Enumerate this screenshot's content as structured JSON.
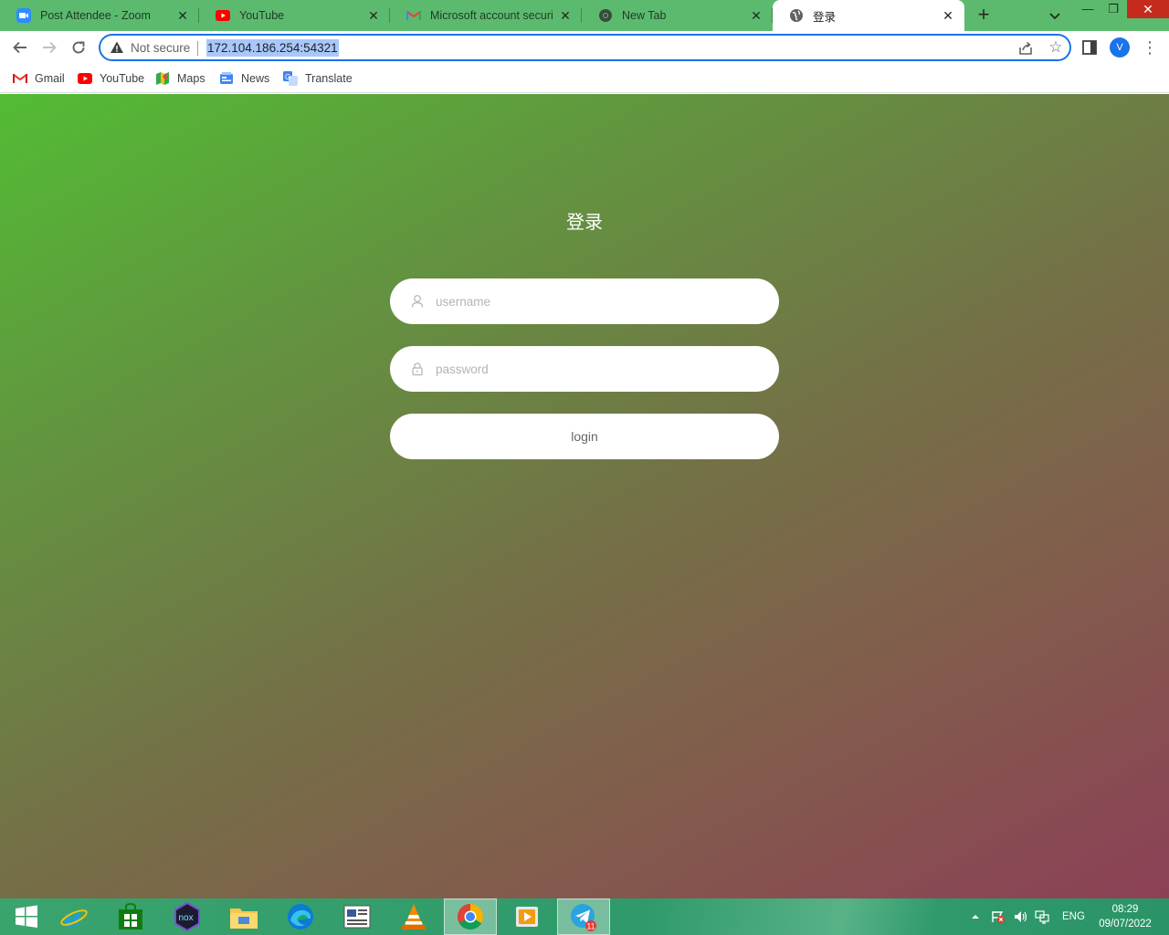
{
  "browser": {
    "tabs": [
      {
        "title": "Post Attendee - Zoom",
        "icon": "zoom-icon"
      },
      {
        "title": "YouTube",
        "icon": "youtube-icon"
      },
      {
        "title": "Microsoft account security",
        "icon": "gmail-icon"
      },
      {
        "title": "New Tab",
        "icon": "chrome-icon"
      },
      {
        "title": "登录",
        "icon": "globe-icon",
        "active": true
      }
    ],
    "address": {
      "security_label": "Not secure",
      "url": "172.104.186.254:54321"
    },
    "profile_initial": "V",
    "bookmarks": [
      {
        "label": "Gmail",
        "icon": "gmail-icon"
      },
      {
        "label": "YouTube",
        "icon": "youtube-icon"
      },
      {
        "label": "Maps",
        "icon": "maps-icon"
      },
      {
        "label": "News",
        "icon": "news-icon"
      },
      {
        "label": "Translate",
        "icon": "translate-icon"
      }
    ]
  },
  "page": {
    "title": "登录",
    "username_placeholder": "username",
    "password_placeholder": "password",
    "login_label": "login",
    "colors": {
      "gradient_start": "#52bc34",
      "gradient_end": "#8c4056",
      "field_background": "#ffffff"
    }
  },
  "taskbar": {
    "apps": [
      "windows-start-icon",
      "internet-explorer-icon",
      "store-icon",
      "nox-icon",
      "file-explorer-icon",
      "edge-icon",
      "news-app-icon",
      "vlc-icon",
      "chrome-icon",
      "media-player-icon",
      "telegram-icon"
    ],
    "telegram_badge": "11",
    "language": "ENG",
    "time": "08:29",
    "date": "09/07/2022"
  }
}
